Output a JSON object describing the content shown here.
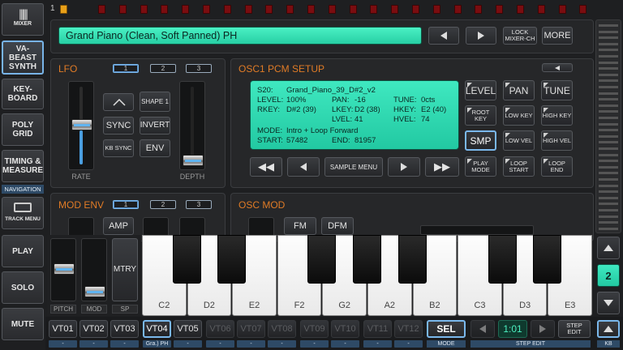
{
  "colors": {
    "accent": "#e07b26",
    "lcd": "#2fdcb2",
    "selected": "#7ab8ec",
    "led": "#7a0d10"
  },
  "topbar": {
    "track_number": "1"
  },
  "preset": {
    "name": "Grand Piano (Clean, Soft Panned) PH",
    "lock_label": "LOCK MIXER-CH",
    "more_label": "MORE"
  },
  "nav": {
    "mixer": "MIXER",
    "items": [
      {
        "label": "VA-BEAST SYNTH"
      },
      {
        "label": "KEY-BOARD"
      },
      {
        "label": "POLY GRID"
      },
      {
        "label": "TIMING & MEASURE"
      }
    ],
    "navigation_label": "NAVIGATION",
    "track_menu": "TRACK MENU",
    "play": "PLAY",
    "solo": "SOLO",
    "mute": "MUTE"
  },
  "lfo": {
    "title": "LFO",
    "pages": [
      "1",
      "2",
      "3"
    ],
    "shape_label": "SHAPE 1",
    "sync": "SYNC",
    "invert": "INVERT",
    "kb_sync": "KB SYNC",
    "env": "ENV",
    "rate": "RATE",
    "depth": "DEPTH"
  },
  "osc1": {
    "title": "OSC1 PCM SETUP",
    "lcd": {
      "sample": "S20:",
      "sample_name": "Grand_Piano_39_D#2_v2",
      "level_k": "LEVEL:",
      "level_v": "100%",
      "pan_k": "PAN:",
      "pan_v": "-16",
      "tune_k": "TUNE:",
      "tune_v": "0cts",
      "rkey_k": "RKEY:",
      "rkey_v": "D#2 (39)",
      "lkey_k": "LKEY:",
      "lkey_v": "D2 (38)",
      "hkey_k": "HKEY:",
      "hkey_v": "E2 (40)",
      "lvel_k": "LVEL:",
      "lvel_v": "41",
      "hvel_k": "HVEL:",
      "hvel_v": "74",
      "mode_k": "MODE:",
      "mode_v": "Intro + Loop Forward",
      "start_k": "START:",
      "start_v": "57482",
      "end_k": "END:",
      "end_v": "81957"
    },
    "buttons": {
      "level": "LEVEL",
      "pan": "PAN",
      "tune": "TUNE",
      "root_key": "ROOT KEY",
      "low_key": "LOW KEY",
      "high_key": "HIGH KEY",
      "smp": "SMP",
      "low_vel": "LOW VEL",
      "high_vel": "HIGH VEL",
      "play_mode": "PLAY MODE",
      "loop_start": "LOOP START",
      "loop_end": "LOOP END",
      "sample_menu": "SAMPLE MENU"
    }
  },
  "modenv": {
    "title": "MOD ENV",
    "pages": [
      "1",
      "2",
      "3"
    ],
    "amp": "AMP"
  },
  "oscmod": {
    "title": "OSC MOD",
    "fm": "FM",
    "dfm": "DFM"
  },
  "controls": {
    "pitch": "PITCH",
    "mod": "MOD",
    "sp": "SP",
    "mtry": "MTRY"
  },
  "keyboard": {
    "labels": [
      "C2",
      "D2",
      "E2",
      "F2",
      "G2",
      "A2",
      "B2",
      "C3",
      "D3",
      "E3"
    ]
  },
  "octave": {
    "value": "2"
  },
  "tracks": [
    {
      "label": "VT01",
      "sub": "-"
    },
    {
      "label": "VT02",
      "sub": "-"
    },
    {
      "label": "VT03",
      "sub": "-"
    },
    {
      "label": "VT04",
      "sub": "Gra.) PH"
    },
    {
      "label": "VT05",
      "sub": "-"
    },
    {
      "label": "VT06",
      "sub": "-"
    },
    {
      "label": "VT07",
      "sub": "-"
    },
    {
      "label": "VT08",
      "sub": "-"
    },
    {
      "label": "VT09",
      "sub": "-"
    },
    {
      "label": "VT10",
      "sub": "-"
    },
    {
      "label": "VT11",
      "sub": "-"
    },
    {
      "label": "VT12",
      "sub": "-"
    }
  ],
  "bottom": {
    "sel": "SEL",
    "mode": "MODE",
    "step_pos": "1:01",
    "step_edit_btn": "STEP EDIT",
    "step_edit": "STEP EDIT",
    "kb": "KB"
  }
}
